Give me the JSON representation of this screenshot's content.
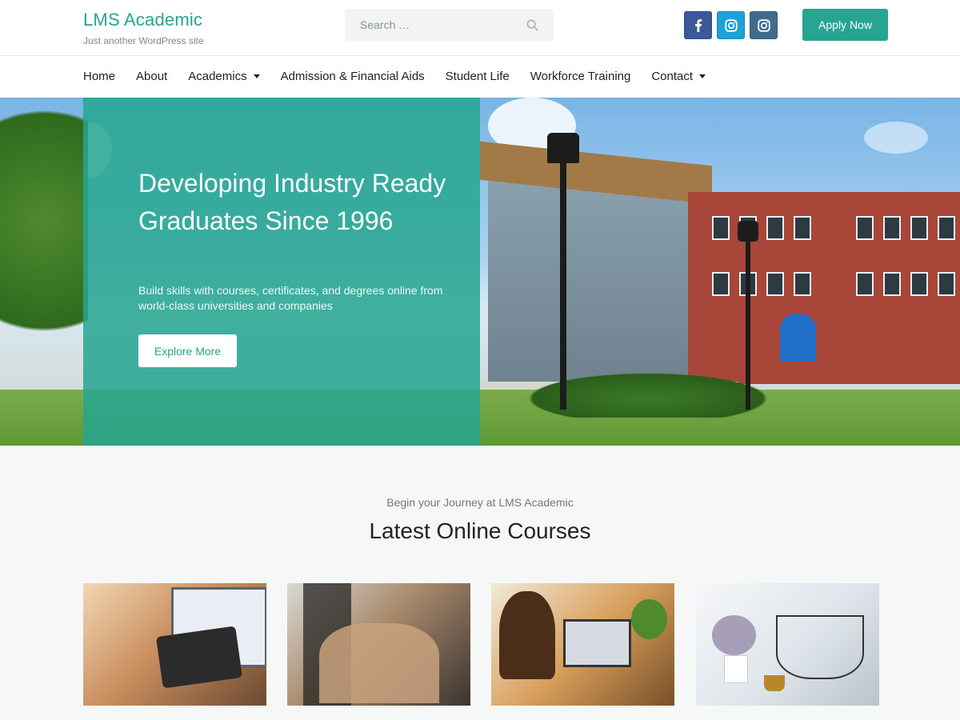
{
  "header": {
    "site_title": "LMS Academic",
    "tagline": "Just another WordPress site",
    "search_placeholder": "Search …",
    "apply_label": "Apply Now",
    "social": [
      {
        "icon": "facebook-icon",
        "color": "#3b5998"
      },
      {
        "icon": "instagram-icon",
        "color": "#1da1d6"
      },
      {
        "icon": "instagram-icon",
        "color": "#3f6b8c"
      }
    ],
    "accent_color": "#27a590"
  },
  "nav": {
    "items": [
      {
        "label": "Home"
      },
      {
        "label": "About"
      },
      {
        "label": "Academics"
      },
      {
        "label": "Admission & Financial Aids"
      },
      {
        "label": "Student Life"
      },
      {
        "label": "Workforce Training"
      },
      {
        "label": "Contact"
      }
    ]
  },
  "hero": {
    "title": "Developing Industry Ready Graduates Since 1996",
    "subtitle": "Build skills with courses, certificates, and degrees online from world-class universities and companies",
    "button_label": "Explore More"
  },
  "courses": {
    "kicker": "Begin your Journey at LMS Academic",
    "title": "Latest Online Courses"
  }
}
